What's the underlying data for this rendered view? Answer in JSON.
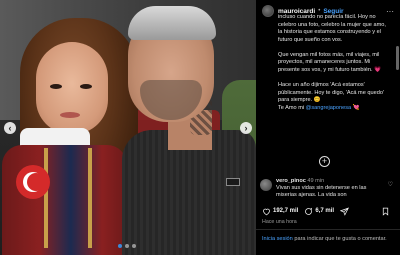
{
  "post": {
    "username": "mauroicardi",
    "separator": "•",
    "follow_label": "Seguir",
    "more_label": "···"
  },
  "caption": {
    "paragraphs": [
      "incluso cuando no parecía fácil. Hoy no celebro una foto, celebro la mujer que amo, la historia que estamos construyendo y el futuro que sueño con vos.",
      "Que vengan mil fotos más, mil viajes, mil proyectos, mil amaneceres juntos. Mi presente sos vos, y mi futuro también. 💗",
      "Hace un año dijimos 'Acá estamos' públicamente. Hoy te digo, 'Acá me quedo' para siempre. 😊"
    ],
    "last_line_prefix": "Te Amo mi ",
    "mention": "@sangrejaponesa",
    "last_line_suffix": " 💘"
  },
  "add_icon": "+",
  "comment": {
    "username": "vero_pinoc",
    "time": "49 min",
    "text": "Vivan sus vidas sin detenerse en las miserias ajenas. La vida son"
  },
  "actions": {
    "likes": "192,7 mil",
    "comments": "6,7 mil"
  },
  "timestamp": "Hace una hora",
  "login": {
    "link": "Inicia sesión",
    "text": " para indicar que te gusta o comentar."
  },
  "carousel": {
    "prev_arrow": "‹",
    "next_arrow": "›"
  },
  "colors": {
    "accent": "#4aa3ff",
    "background": "#000000",
    "text": "#f5f5f5",
    "muted": "#9a9a9a"
  }
}
